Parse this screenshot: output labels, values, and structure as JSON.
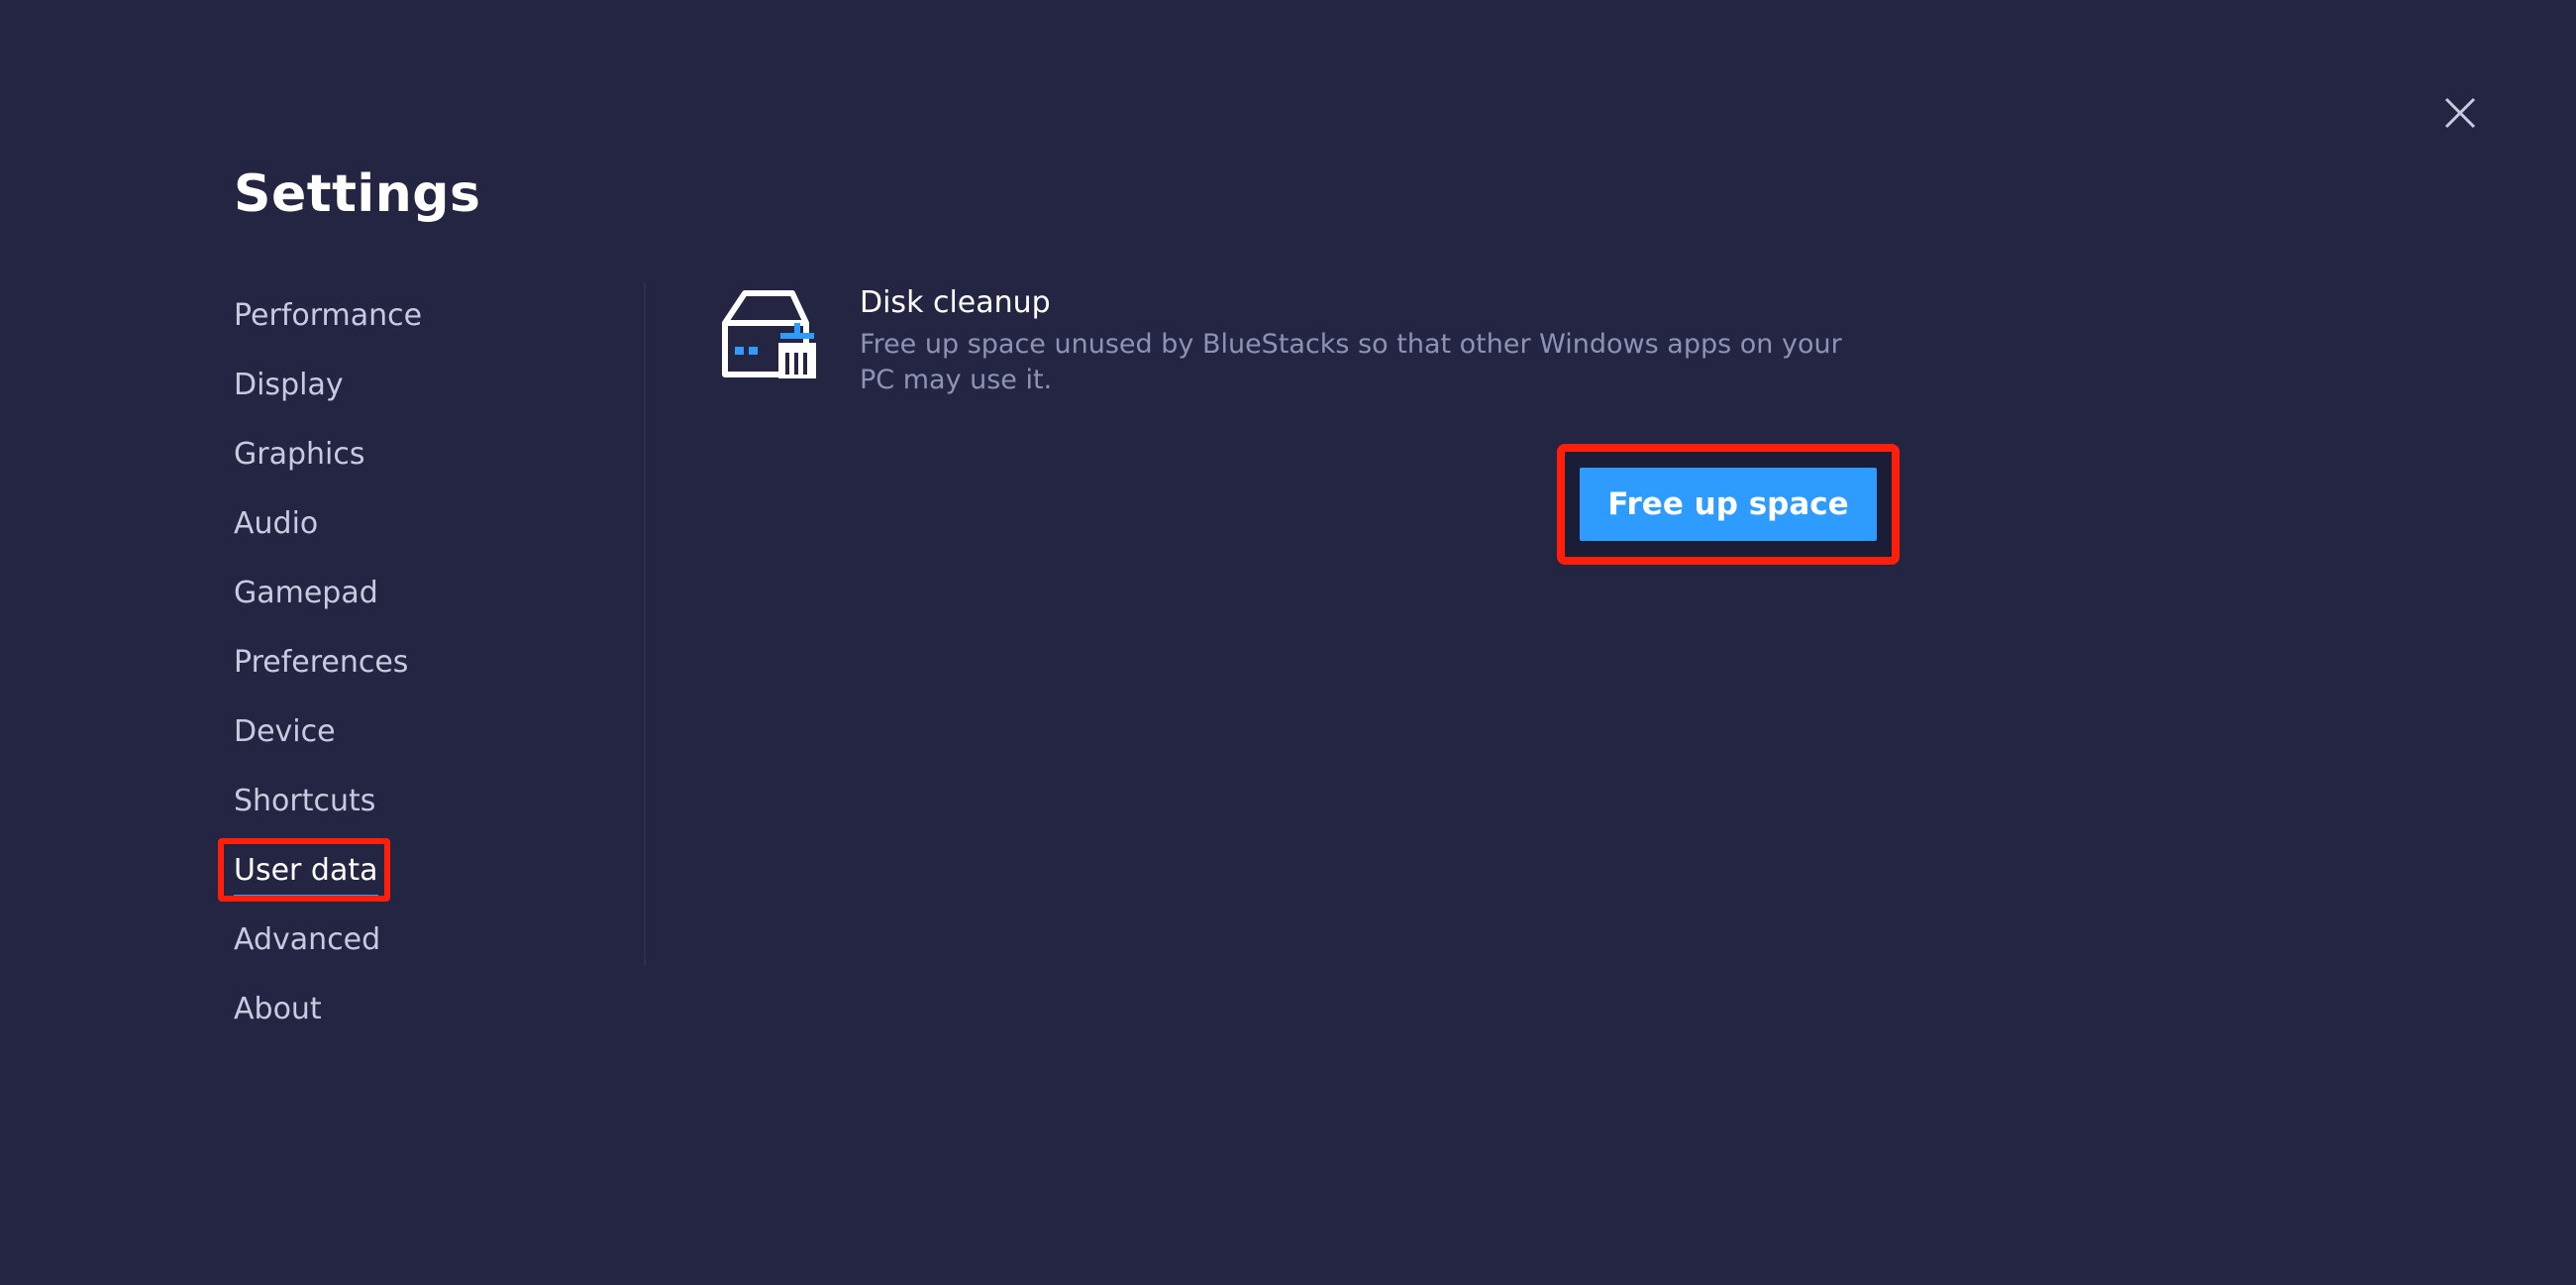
{
  "window": {
    "title": "Settings",
    "close_icon": "close-icon"
  },
  "sidebar": {
    "items": [
      {
        "label": "Performance",
        "active": false
      },
      {
        "label": "Display",
        "active": false
      },
      {
        "label": "Graphics",
        "active": false
      },
      {
        "label": "Audio",
        "active": false
      },
      {
        "label": "Gamepad",
        "active": false
      },
      {
        "label": "Preferences",
        "active": false
      },
      {
        "label": "Device",
        "active": false
      },
      {
        "label": "Shortcuts",
        "active": false
      },
      {
        "label": "User data",
        "active": true
      },
      {
        "label": "Advanced",
        "active": false
      },
      {
        "label": "About",
        "active": false
      }
    ]
  },
  "main": {
    "section": {
      "icon": "disk-cleanup-icon",
      "title": "Disk cleanup",
      "description": "Free up space unused by BlueStacks so that other Windows apps on your PC may use it.",
      "button_label": "Free up space"
    }
  },
  "colors": {
    "background": "#232543",
    "accent": "#2d9bff",
    "highlight": "#ff1f0a",
    "muted_text": "#8f93b3"
  }
}
